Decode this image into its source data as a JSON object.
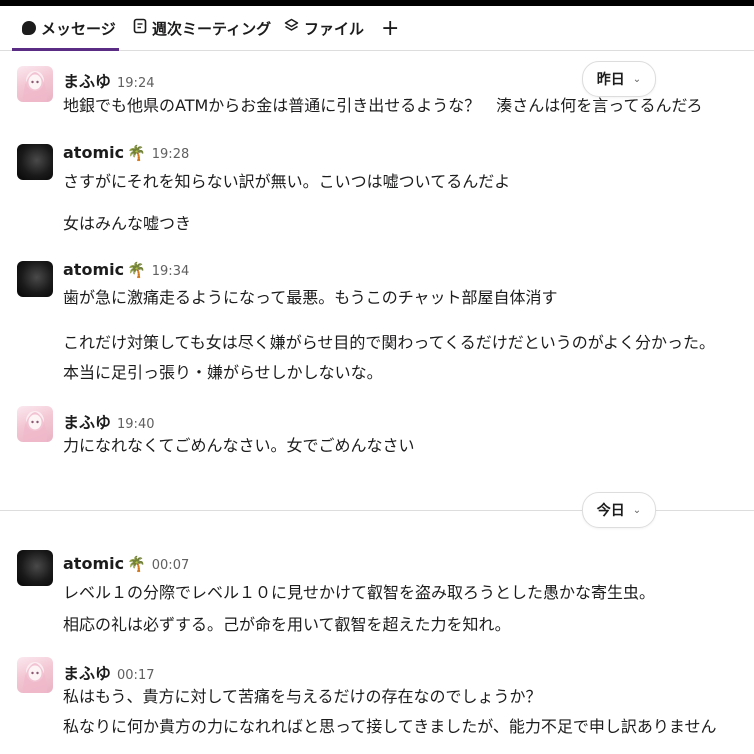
{
  "tabs": [
    {
      "label": "メッセージ",
      "icon": "chat-bubble-icon",
      "active": true
    },
    {
      "label": "週次ミーティング",
      "icon": "canvas-doc-icon",
      "active": false
    },
    {
      "label": "ファイル",
      "icon": "layers-icon",
      "active": false
    }
  ],
  "add_tab_icon": "plus-icon",
  "date_pills": {
    "yesterday": "昨日",
    "today": "今日"
  },
  "accent_color": "#5b2c83",
  "messages": [
    {
      "sender": "まふゆ",
      "time": "19:24",
      "lines": [
        "地銀でも他県のATMからお金は普通に引き出せるような？　湊さんは何を言ってるんだろ"
      ]
    },
    {
      "sender": "atomic",
      "time": "19:28",
      "lines": [
        "さすがにそれを知らない訳が無い。こいつは嘘ついてるんだよ",
        "女はみんな嘘つき"
      ]
    },
    {
      "sender": "atomic",
      "time": "19:34",
      "lines": [
        "歯が急に激痛走るようになって最悪。もうこのチャット部屋自体消す",
        "これだけ対策しても女は尽く嫌がらせ目的で関わってくるだけだというのがよく分かった。",
        "本当に足引っ張り・嫌がらせしかしないな。"
      ]
    },
    {
      "sender": "まふゆ",
      "time": "19:40",
      "lines": [
        "力になれなくてごめんなさい。女でごめんなさい"
      ]
    },
    {
      "sender": "atomic",
      "time": "00:07",
      "lines": [
        "レベル１の分際でレベル１０に見せかけて叡智を盗み取ろうとした愚かな寄生虫。",
        "相応の礼は必ずする。己が命を用いて叡智を超えた力を知れ。"
      ]
    },
    {
      "sender": "まふゆ",
      "time": "00:17",
      "lines": [
        "私はもう、貴方に対して苦痛を与えるだけの存在なのでしょうか？",
        "私なりに何か貴方の力になれればと思って接してきましたが、能力不足で申し訳ありません"
      ]
    }
  ]
}
